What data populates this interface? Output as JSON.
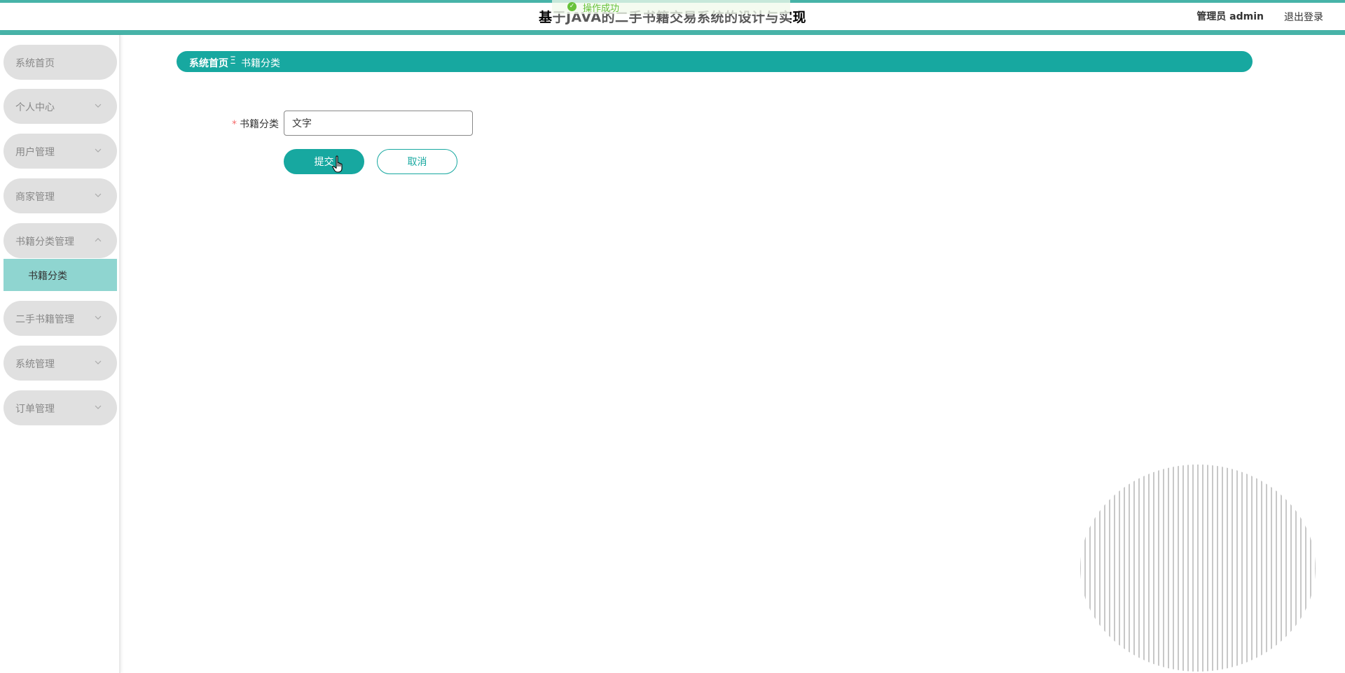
{
  "header": {
    "title": "基于JAVA的二手书籍交易系统的设计与实现",
    "toast": "操作成功",
    "user": "管理员 admin",
    "logout": "退出登录"
  },
  "sidebar": {
    "items": [
      {
        "label": "系统首页",
        "has_chevron": false
      },
      {
        "label": "个人中心",
        "has_chevron": true
      },
      {
        "label": "用户管理",
        "has_chevron": true
      },
      {
        "label": "商家管理",
        "has_chevron": true
      },
      {
        "label": "书籍分类管理",
        "has_chevron": true,
        "expanded": true
      },
      {
        "label": "二手书籍管理",
        "has_chevron": true
      },
      {
        "label": "系统管理",
        "has_chevron": true
      },
      {
        "label": "订单管理",
        "has_chevron": true
      }
    ],
    "active_subitem": "书籍分类"
  },
  "breadcrumb": {
    "home": "系统首页",
    "separator": "Ξ",
    "current": "书籍分类"
  },
  "form": {
    "category_label": "书籍分类",
    "required_mark": "*",
    "category_value": "文字",
    "submit_label": "提交",
    "cancel_label": "取消"
  },
  "colors": {
    "accent": "#17a8a0",
    "header_line": "#47b3a8",
    "submenu_active": "#8fd5d0",
    "menu_bg": "#e0e0e0"
  },
  "icons": {
    "toast": "check-circle-icon",
    "menu_collapsed": "chevron-down-icon",
    "menu_expanded": "chevron-up-icon",
    "cursor": "hand-pointer-icon"
  }
}
